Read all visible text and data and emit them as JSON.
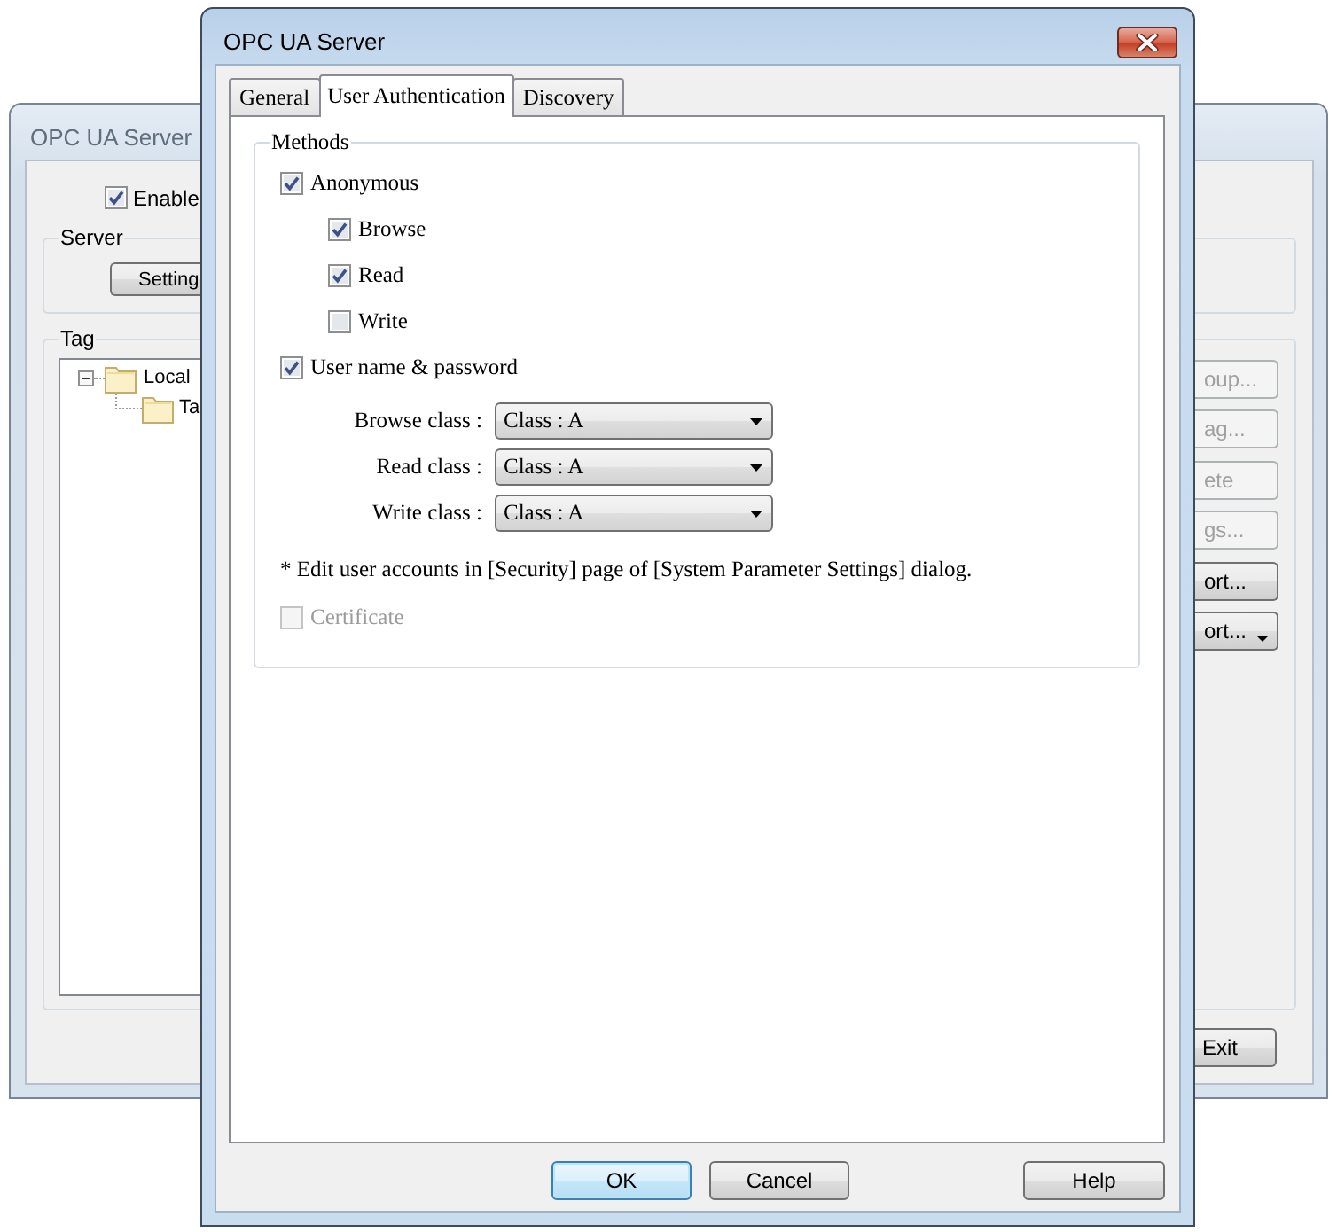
{
  "background_window": {
    "title": "OPC UA Server",
    "enable_checkbox": {
      "label": "Enable",
      "checked": true
    },
    "server_group": {
      "label": "Server",
      "button": "Setting"
    },
    "tag_group": {
      "label": "Tag",
      "tree": [
        {
          "label": "Local",
          "expanded": true,
          "children": [
            {
              "label": "Ta"
            }
          ]
        }
      ],
      "buttons": [
        {
          "label": "oup...",
          "disabled": true,
          "menu": false
        },
        {
          "label": "ag...",
          "disabled": true,
          "menu": false
        },
        {
          "label": "ete",
          "disabled": true,
          "menu": false
        },
        {
          "label": "gs...",
          "disabled": true,
          "menu": false
        },
        {
          "label": "ort...",
          "disabled": false,
          "menu": false
        },
        {
          "label": "ort...",
          "disabled": false,
          "menu": true
        }
      ]
    },
    "exit_button": "Exit"
  },
  "dialog": {
    "title": "OPC UA Server",
    "tabs": [
      {
        "label": "General",
        "selected": false
      },
      {
        "label": "User Authentication",
        "selected": true
      },
      {
        "label": "Discovery",
        "selected": false
      }
    ],
    "methods": {
      "label": "Methods",
      "anonymous": {
        "label": "Anonymous",
        "checked": true,
        "permissions": [
          {
            "label": "Browse",
            "checked": true
          },
          {
            "label": "Read",
            "checked": true
          },
          {
            "label": "Write",
            "checked": false
          }
        ]
      },
      "user_password": {
        "label": "User name & password",
        "checked": true,
        "classes": [
          {
            "label": "Browse class :",
            "value": "Class : A"
          },
          {
            "label": "Read class :",
            "value": "Class : A"
          },
          {
            "label": "Write class :",
            "value": "Class : A"
          }
        ]
      },
      "note": "* Edit user accounts in [Security] page of [System Parameter Settings] dialog.",
      "certificate": {
        "label": "Certificate",
        "checked": false,
        "disabled": true
      }
    },
    "buttons": [
      {
        "label": "OK",
        "default": true
      },
      {
        "label": "Cancel",
        "default": false
      }
    ],
    "help_button": "Help"
  }
}
